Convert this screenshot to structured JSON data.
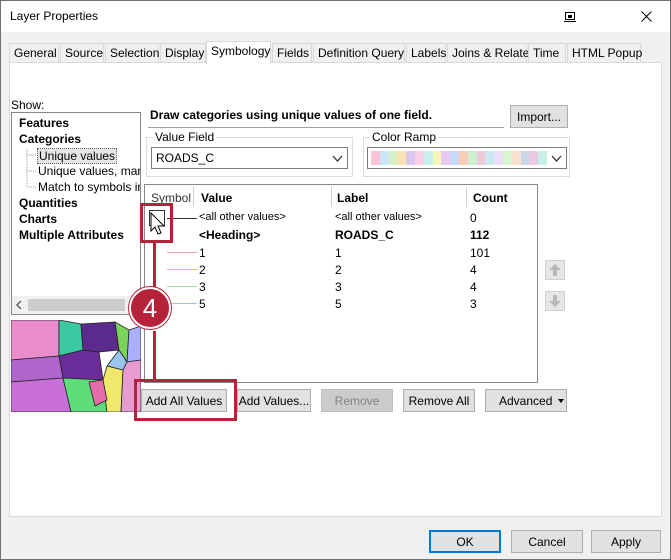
{
  "window": {
    "title": "Layer Properties"
  },
  "tabs": [
    {
      "label": "General"
    },
    {
      "label": "Source"
    },
    {
      "label": "Selection"
    },
    {
      "label": "Display"
    },
    {
      "label": "Symbology"
    },
    {
      "label": "Fields"
    },
    {
      "label": "Definition Query"
    },
    {
      "label": "Labels"
    },
    {
      "label": "Joins & Relates"
    },
    {
      "label": "Time"
    },
    {
      "label": "HTML Popup"
    }
  ],
  "show": {
    "label": "Show:",
    "items": [
      {
        "label": "Features"
      },
      {
        "label": "Categories"
      },
      {
        "label": "Unique values"
      },
      {
        "label": "Unique values, many"
      },
      {
        "label": "Match to symbols in a"
      },
      {
        "label": "Quantities"
      },
      {
        "label": "Charts"
      },
      {
        "label": "Multiple Attributes"
      }
    ]
  },
  "symbology": {
    "description": "Draw categories using unique values of one field.",
    "import_label": "Import...",
    "value_field_label": "Value Field",
    "value_field_value": "ROADS_C",
    "color_ramp_label": "Color Ramp",
    "color_ramp_colors": [
      "#f9c4d8",
      "#c8e6f9",
      "#d4f0c4",
      "#f9e3b5",
      "#d9c9f0",
      "#f9d0e7",
      "#c9f0ec",
      "#f5f5b8",
      "#e6c9f0",
      "#c8d8f9",
      "#f9cdb8",
      "#cdf0d0",
      "#f0c9d6",
      "#c9e8f0",
      "#ece0f9",
      "#d9f5d0",
      "#f9e0d0",
      "#c9d8e8",
      "#e9c9e0",
      "#c8f0e8"
    ],
    "columns": {
      "symbol": "Symbol",
      "value": "Value",
      "label": "Label",
      "count": "Count"
    },
    "rows": [
      {
        "value": "<all other values>",
        "label": "<all other values>",
        "count": "0",
        "bold": false,
        "color": ""
      },
      {
        "value": "<Heading>",
        "label": "ROADS_C",
        "count": "112",
        "bold": true,
        "color": ""
      },
      {
        "value": "1",
        "label": "1",
        "count": "101",
        "bold": false,
        "color": "#f4a0c0"
      },
      {
        "value": "2",
        "label": "2",
        "count": "4",
        "bold": false,
        "color": "#e0c060"
      },
      {
        "value": "3",
        "label": "3",
        "count": "4",
        "bold": false,
        "color": "#a0e0a0"
      },
      {
        "value": "5",
        "label": "5",
        "count": "3",
        "bold": false,
        "color": "#a0c0f0"
      }
    ],
    "buttons": {
      "add_all": "Add All Values",
      "add_values": "Add Values...",
      "remove": "Remove",
      "remove_all": "Remove All",
      "advanced": "Advanced"
    }
  },
  "annotation": {
    "step": "4",
    "accent": "#b5233a"
  },
  "footer": {
    "ok": "OK",
    "cancel": "Cancel",
    "apply": "Apply"
  }
}
